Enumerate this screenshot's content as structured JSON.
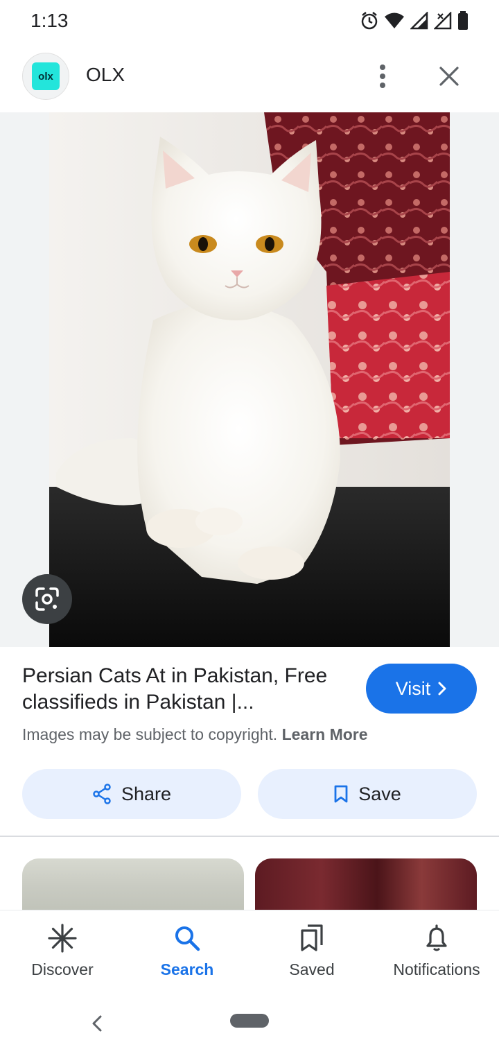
{
  "status_bar": {
    "time": "1:13"
  },
  "header": {
    "logo_text": "olx",
    "site_name": "OLX"
  },
  "image": {
    "subject": "white persian cat"
  },
  "result": {
    "title": "Persian Cats At in Pakistan, Free classifieds in Pakistan |...",
    "visit_label": "Visit",
    "copyright_text": "Images may be subject to copyright.",
    "learn_more_label": "Learn More",
    "share_label": "Share",
    "save_label": "Save"
  },
  "bottom_nav": {
    "items": [
      {
        "label": "Discover",
        "icon": "asterisk-icon",
        "active": false
      },
      {
        "label": "Search",
        "icon": "search-icon",
        "active": true
      },
      {
        "label": "Saved",
        "icon": "bookmarks-icon",
        "active": false
      },
      {
        "label": "Notifications",
        "icon": "bell-icon",
        "active": false
      }
    ]
  },
  "colors": {
    "accent": "#1a73e8",
    "chip_background": "#e8f0fe",
    "olx_brand": "#23e5db"
  }
}
